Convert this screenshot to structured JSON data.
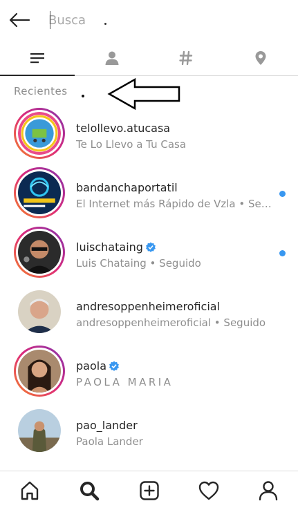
{
  "search": {
    "placeholder": "Busca",
    "value": ""
  },
  "tabs": [
    {
      "name": "top",
      "icon": "list-icon",
      "active": true
    },
    {
      "name": "people",
      "icon": "person-icon"
    },
    {
      "name": "tags",
      "icon": "hashtag-icon"
    },
    {
      "name": "places",
      "icon": "location-pin-icon"
    }
  ],
  "recent_label": "Recientes",
  "results": [
    {
      "username": "telollevo.atucasa",
      "subtitle": "Te Lo Llevo a Tu Casa",
      "verified": false,
      "story": true,
      "unread": false
    },
    {
      "username": "bandanchaportatil",
      "subtitle": "El Internet más Rápido de Vzla • Seg...",
      "verified": false,
      "story": true,
      "unread": true
    },
    {
      "username": "luischataing",
      "subtitle": "Luis Chataing • Seguido",
      "verified": true,
      "story": true,
      "unread": true
    },
    {
      "username": "andresoppenheimeroficial",
      "subtitle": "andresoppenheimeroficial • Seguido",
      "verified": false,
      "story": false,
      "unread": false
    },
    {
      "username": "paola",
      "subtitle": "PAOLA MARIA",
      "verified": true,
      "story": true,
      "unread": false
    },
    {
      "username": "pao_lander",
      "subtitle": "Paola Lander",
      "verified": false,
      "story": false,
      "unread": false
    }
  ],
  "bottom_nav": [
    "home-icon",
    "search-icon",
    "new-post-icon",
    "activity-heart-icon",
    "profile-icon"
  ],
  "colors": {
    "verified": "#3897f0",
    "unread": "#3897f0",
    "muted": "#8e8e8e"
  }
}
